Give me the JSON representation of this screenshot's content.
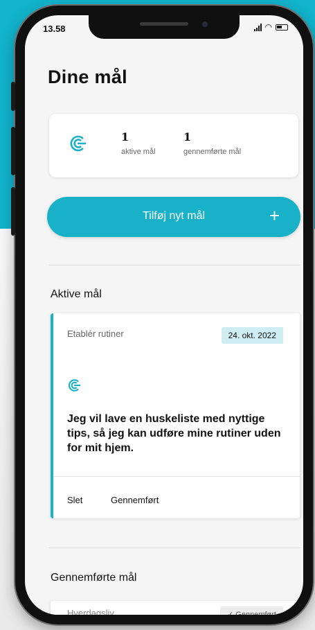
{
  "status_bar": {
    "time": "13.58"
  },
  "page": {
    "title": "Dine mål"
  },
  "stats": {
    "active_count": "1",
    "active_label": "aktive mål",
    "completed_count": "1",
    "completed_label": "gennemførte mål"
  },
  "add_button": {
    "label": "Tilføj nyt mål",
    "icon": "plus-icon"
  },
  "active_section": {
    "title": "Aktive mål",
    "goals": [
      {
        "category": "Etablér rutiner",
        "date": "24. okt. 2022",
        "text": "Jeg vil lave en huskeliste med nyttige tips, så jeg kan udføre mine rutiner uden for mit hjem.",
        "actions": [
          "Slet",
          "Gennemført"
        ]
      }
    ]
  },
  "completed_section": {
    "title": "Gennemførte mål",
    "goals": [
      {
        "category": "Hverdagsliv",
        "badge": "✓ Gennemført"
      }
    ]
  },
  "colors": {
    "accent": "#19b1c8",
    "background_band": "#12b3cc",
    "date_badge": "#cfedf3"
  }
}
